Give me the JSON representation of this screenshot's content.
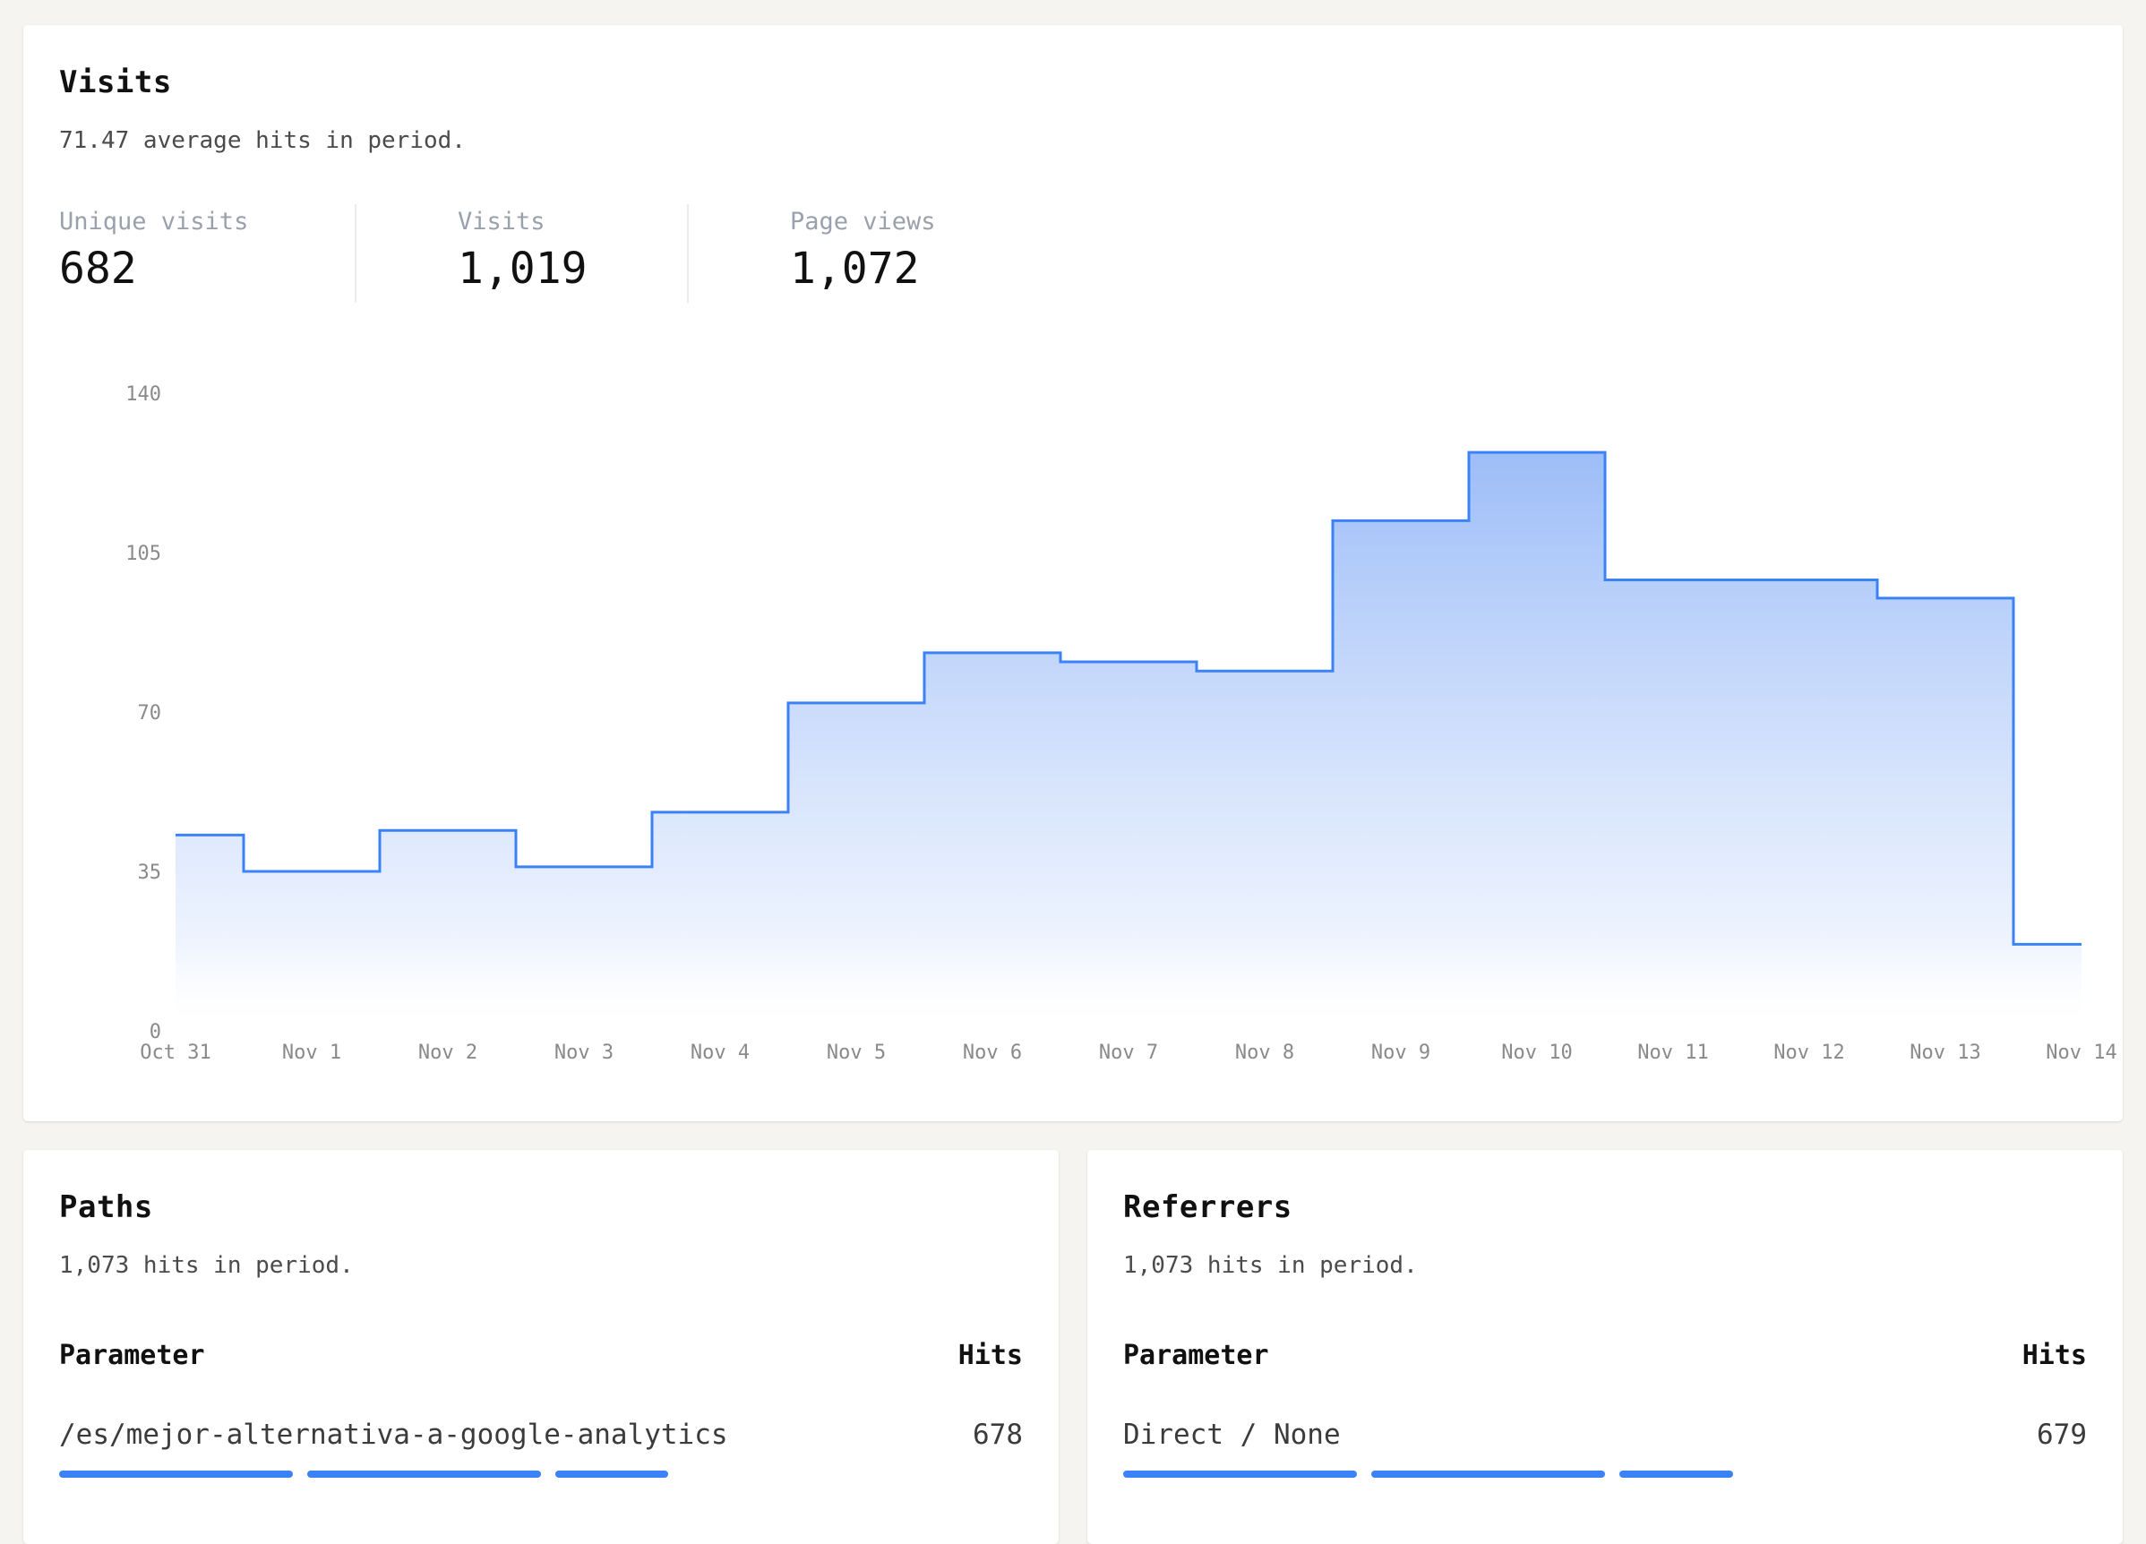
{
  "visits": {
    "title": "Visits",
    "subtitle": "71.47 average hits in period.",
    "stats": [
      {
        "label": "Unique visits",
        "value": "682"
      },
      {
        "label": "Visits",
        "value": "1,019"
      },
      {
        "label": "Page views",
        "value": "1,072"
      }
    ]
  },
  "colors": {
    "accent": "#3b82f6",
    "fill_top": "#9dbdf8",
    "background": "#f5f4f0"
  },
  "chart_data": {
    "type": "area",
    "step": "middle",
    "title": "",
    "xlabel": "",
    "ylabel": "",
    "categories": [
      "Oct 31",
      "Nov 1",
      "Nov 2",
      "Nov 3",
      "Nov 4",
      "Nov 5",
      "Nov 6",
      "Nov 7",
      "Nov 8",
      "Nov 9",
      "Nov 10",
      "Nov 11",
      "Nov 12",
      "Nov 13",
      "Nov 14"
    ],
    "series": [
      {
        "name": "Hits",
        "values": [
          43,
          35,
          44,
          36,
          48,
          72,
          83,
          81,
          79,
          112,
          127,
          99,
          99,
          95,
          19
        ]
      }
    ],
    "ylim": [
      0,
      140
    ],
    "yticks": [
      0,
      35,
      70,
      105,
      140
    ],
    "grid": false,
    "legend": "none"
  },
  "paths": {
    "title": "Paths",
    "subtitle": "1,073 hits in period.",
    "columns": {
      "parameter": "Parameter",
      "hits": "Hits"
    },
    "rows": [
      {
        "parameter": "/es/mejor-alternativa-a-google-analytics",
        "hits": "678",
        "share": 0.632
      }
    ]
  },
  "referrers": {
    "title": "Referrers",
    "subtitle": "1,073 hits in period.",
    "columns": {
      "parameter": "Parameter",
      "hits": "Hits"
    },
    "rows": [
      {
        "parameter": "Direct / None",
        "hits": "679",
        "share": 0.633
      }
    ]
  }
}
